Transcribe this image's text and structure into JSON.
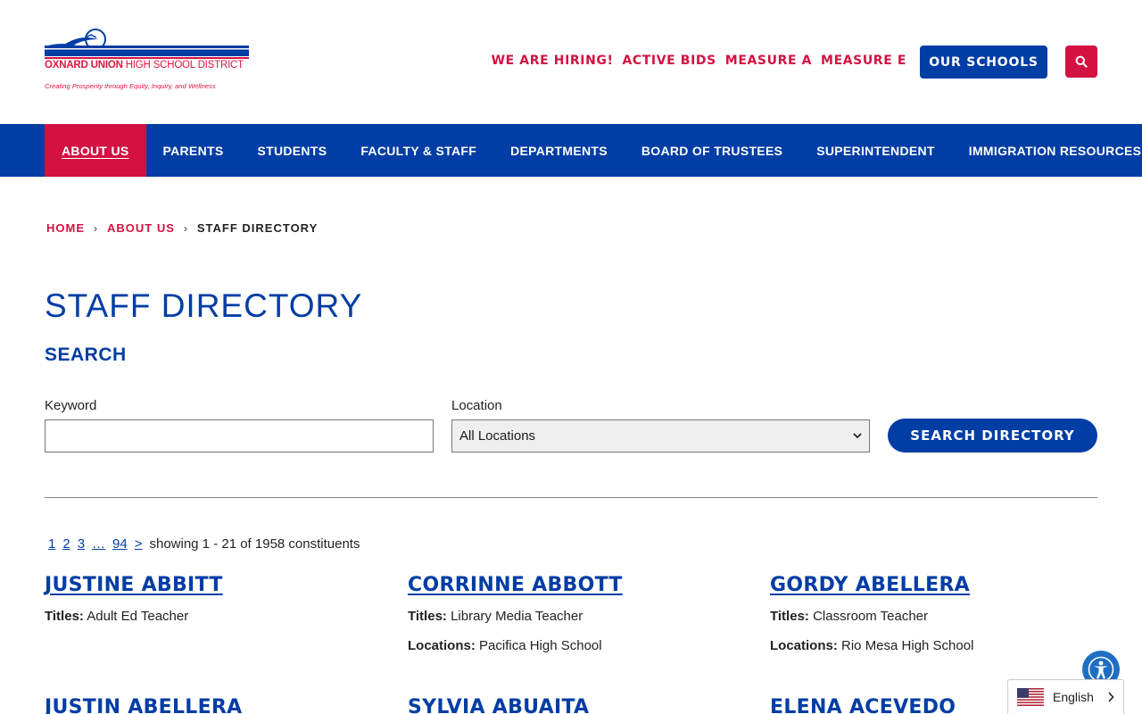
{
  "header": {
    "logo_name_bold": "OXNARD UNION",
    "logo_name_rest": "HIGH SCHOOL DISTRICT",
    "logo_tagline": "Creating Prosperity through Equity, Inquiry, and Wellness",
    "util_links": [
      "WE ARE HIRING!",
      "ACTIVE BIDS",
      "MEASURE A",
      "MEASURE E"
    ],
    "schools_button": "OUR SCHOOLS"
  },
  "nav": {
    "items": [
      "ABOUT US",
      "PARENTS",
      "STUDENTS",
      "FACULTY & STAFF",
      "DEPARTMENTS",
      "BOARD OF TRUSTEES",
      "SUPERINTENDENT",
      "IMMIGRATION RESOURCES"
    ],
    "active": "ABOUT US"
  },
  "breadcrumb": {
    "home": "HOME",
    "parent": "ABOUT US",
    "current": "STAFF DIRECTORY"
  },
  "page": {
    "title": "STAFF DIRECTORY",
    "search_heading": "SEARCH"
  },
  "search": {
    "keyword_label": "Keyword",
    "keyword_value": "",
    "location_label": "Location",
    "location_value": "All Locations",
    "submit_label": "SEARCH DIRECTORY"
  },
  "pager": {
    "pages": [
      "1",
      "2",
      "3",
      "…",
      "94",
      ">"
    ],
    "summary": "showing 1 - 21 of 1958 constituents"
  },
  "labels": {
    "titles": "Titles:",
    "locations": "Locations:"
  },
  "staff": [
    {
      "name": "JUSTINE ABBITT",
      "title": "Adult Ed Teacher",
      "location": ""
    },
    {
      "name": "CORRINNE ABBOTT",
      "title": "Library Media Teacher",
      "location": "Pacifica High School"
    },
    {
      "name": "GORDY ABELLERA",
      "title": "Classroom Teacher",
      "location": "Rio Mesa High School"
    },
    {
      "name": "JUSTIN ABELLERA",
      "title": "",
      "location": ""
    },
    {
      "name": "SYLVIA ABUAITA",
      "title": "",
      "location": ""
    },
    {
      "name": "ELENA ACEVEDO",
      "title": "",
      "location": ""
    }
  ],
  "language": {
    "current": "English"
  },
  "colors": {
    "brand_blue": "#003da5",
    "brand_red": "#d31241"
  }
}
